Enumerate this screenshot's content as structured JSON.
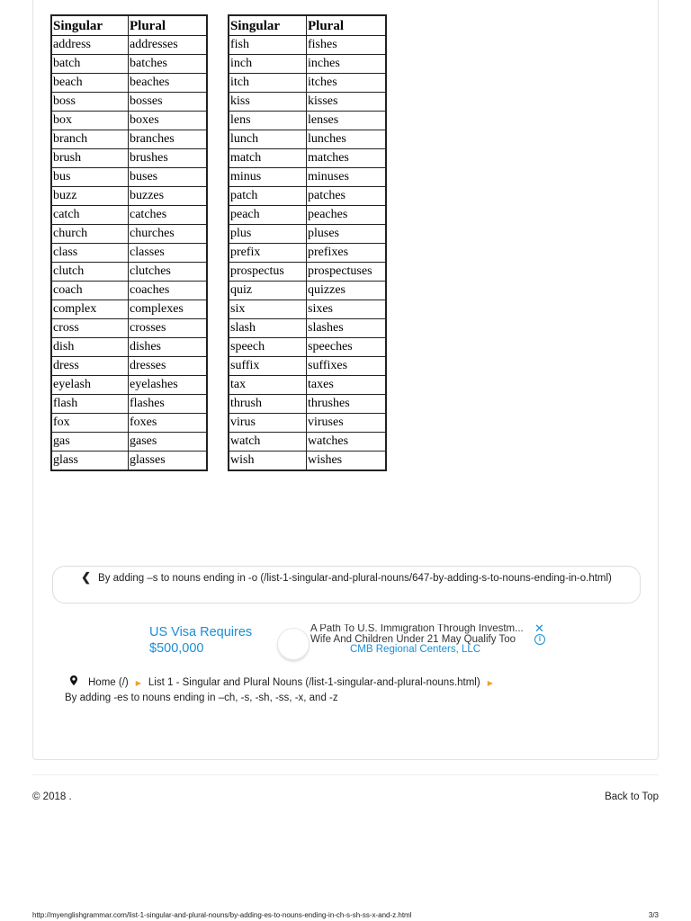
{
  "tables": {
    "headers": [
      "Singular",
      "Plural"
    ],
    "left": [
      [
        "address",
        "addresses"
      ],
      [
        "batch",
        "batches"
      ],
      [
        "beach",
        "beaches"
      ],
      [
        "boss",
        "bosses"
      ],
      [
        "box",
        "boxes"
      ],
      [
        "branch",
        "branches"
      ],
      [
        "brush",
        "brushes"
      ],
      [
        "bus",
        "buses"
      ],
      [
        "buzz",
        "buzzes"
      ],
      [
        "catch",
        "catches"
      ],
      [
        "church",
        "churches"
      ],
      [
        "class",
        "classes"
      ],
      [
        "clutch",
        "clutches"
      ],
      [
        "coach",
        "coaches"
      ],
      [
        "complex",
        "complexes"
      ],
      [
        "cross",
        "crosses"
      ],
      [
        "dish",
        "dishes"
      ],
      [
        "dress",
        "dresses"
      ],
      [
        "eyelash",
        "eyelashes"
      ],
      [
        "flash",
        "flashes"
      ],
      [
        "fox",
        "foxes"
      ],
      [
        "gas",
        "gases"
      ],
      [
        "glass",
        "glasses"
      ]
    ],
    "right": [
      [
        "fish",
        "fishes"
      ],
      [
        "inch",
        "inches"
      ],
      [
        "itch",
        "itches"
      ],
      [
        "kiss",
        "kisses"
      ],
      [
        "lens",
        "lenses"
      ],
      [
        "lunch",
        "lunches"
      ],
      [
        "match",
        "matches"
      ],
      [
        "minus",
        "minuses"
      ],
      [
        "patch",
        "patches"
      ],
      [
        "peach",
        "peaches"
      ],
      [
        "plus",
        "pluses"
      ],
      [
        "prefix",
        "prefixes"
      ],
      [
        "prospectus",
        "prospectuses"
      ],
      [
        "quiz",
        "quizzes"
      ],
      [
        "six",
        "sixes"
      ],
      [
        "slash",
        "slashes"
      ],
      [
        "speech",
        "speeches"
      ],
      [
        "suffix",
        "suffixes"
      ],
      [
        "tax",
        "taxes"
      ],
      [
        "thrush",
        "thrushes"
      ],
      [
        "virus",
        "viruses"
      ],
      [
        "watch",
        "watches"
      ],
      [
        "wish",
        "wishes"
      ]
    ]
  },
  "pager": {
    "icon": "chevron-left-icon",
    "label": "By adding –s to nouns ending in -o (/list-1-singular-and-plural-nouns/647-by-adding-s-to-nouns-ending-in-o.html)"
  },
  "ad": {
    "headline_line1": "US Visa Requires",
    "headline_line2": "$500,000",
    "description_line1": "A Path To U.S. Immigration Through Investm...",
    "description_line2": "Wife And Children Under 21 May Qualify Too",
    "advertiser": "CMB Regional Centers, LLC",
    "close_icon": "close-icon",
    "info_icon": "info-icon",
    "accent_color": "#1a8fd6"
  },
  "breadcrumb": {
    "icon": "map-pin-icon",
    "items": [
      "Home (/)",
      "List 1 - Singular and Plural Nouns (/list-1-singular-and-plural-nouns.html)",
      "By adding -es to nouns ending in –ch, -s, -sh, -ss, -x, and -z"
    ],
    "separator_color": "#f0a030"
  },
  "footer": {
    "copyright": "© 2018 .",
    "back_to_top": "Back to Top"
  },
  "print": {
    "url": "http://myenglishgrammar.com/list-1-singular-and-plural-nouns/by-adding-es-to-nouns-ending-in-ch-s-sh-ss-x-and-z.html",
    "page": "3/3"
  }
}
